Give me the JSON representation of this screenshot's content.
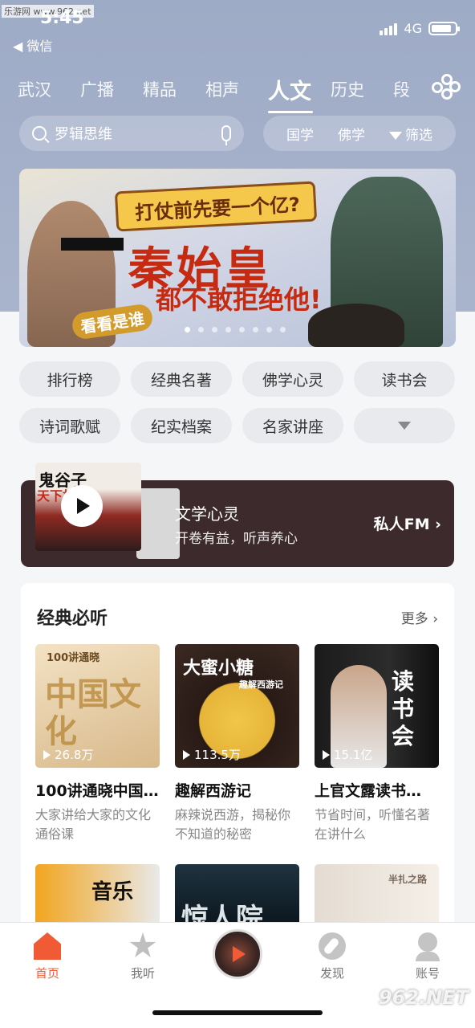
{
  "watermark_top": "乐游网 www.962.net",
  "watermark_bottom": "962.NET",
  "status": {
    "time": "5:45",
    "back_label": "◀ 微信",
    "network": "4G",
    "battery_level": 0.85
  },
  "category_tabs": [
    "武汉",
    "广播",
    "精品",
    "相声",
    "人文",
    "历史",
    "段"
  ],
  "active_tab_index": 4,
  "search": {
    "placeholder": "罗辑思维"
  },
  "filters": {
    "item1": "国学",
    "item2": "佛学",
    "item3": "筛选"
  },
  "banner": {
    "headline_top": "打仗前先要一个亿?",
    "headline_main": "秦始皇",
    "headline_sub": "都不敢拒绝他!",
    "badge": "看看是谁",
    "dot_count": 8,
    "active_dot": 0
  },
  "chips": [
    "排行榜",
    "经典名著",
    "佛学心灵",
    "读书会",
    "诗词歌赋",
    "纪实档案",
    "名家讲座"
  ],
  "fm": {
    "cover_title": "鬼谷子",
    "cover_sub": "天下权术",
    "title": "文学心灵",
    "subtitle": "开卷有益，听声养心",
    "link": "私人FM ›"
  },
  "classic_section": {
    "title": "经典必听",
    "more": "更多 ›",
    "items": [
      {
        "title": "100讲通晓中国…",
        "desc": "大家讲给大家的文化通俗课",
        "plays": "26.8万",
        "art": "100讲通晓",
        "art2": "中国文化"
      },
      {
        "title": "趣解西游记",
        "desc": "麻辣说西游，揭秘你不知道的秘密",
        "plays": "113.5万",
        "art": "大蜜小糖",
        "art2": "趣解西游记"
      },
      {
        "title": "上官文露读书…",
        "desc": "节省时间，听懂名著在讲什么",
        "plays": "15.1亿",
        "art": "读书会",
        "art2": ""
      }
    ],
    "row2_art": [
      "音乐",
      "惊人院",
      "半扎之路"
    ]
  },
  "tabbar": {
    "home": "首页",
    "mine": "我听",
    "discover": "发现",
    "account": "账号"
  }
}
